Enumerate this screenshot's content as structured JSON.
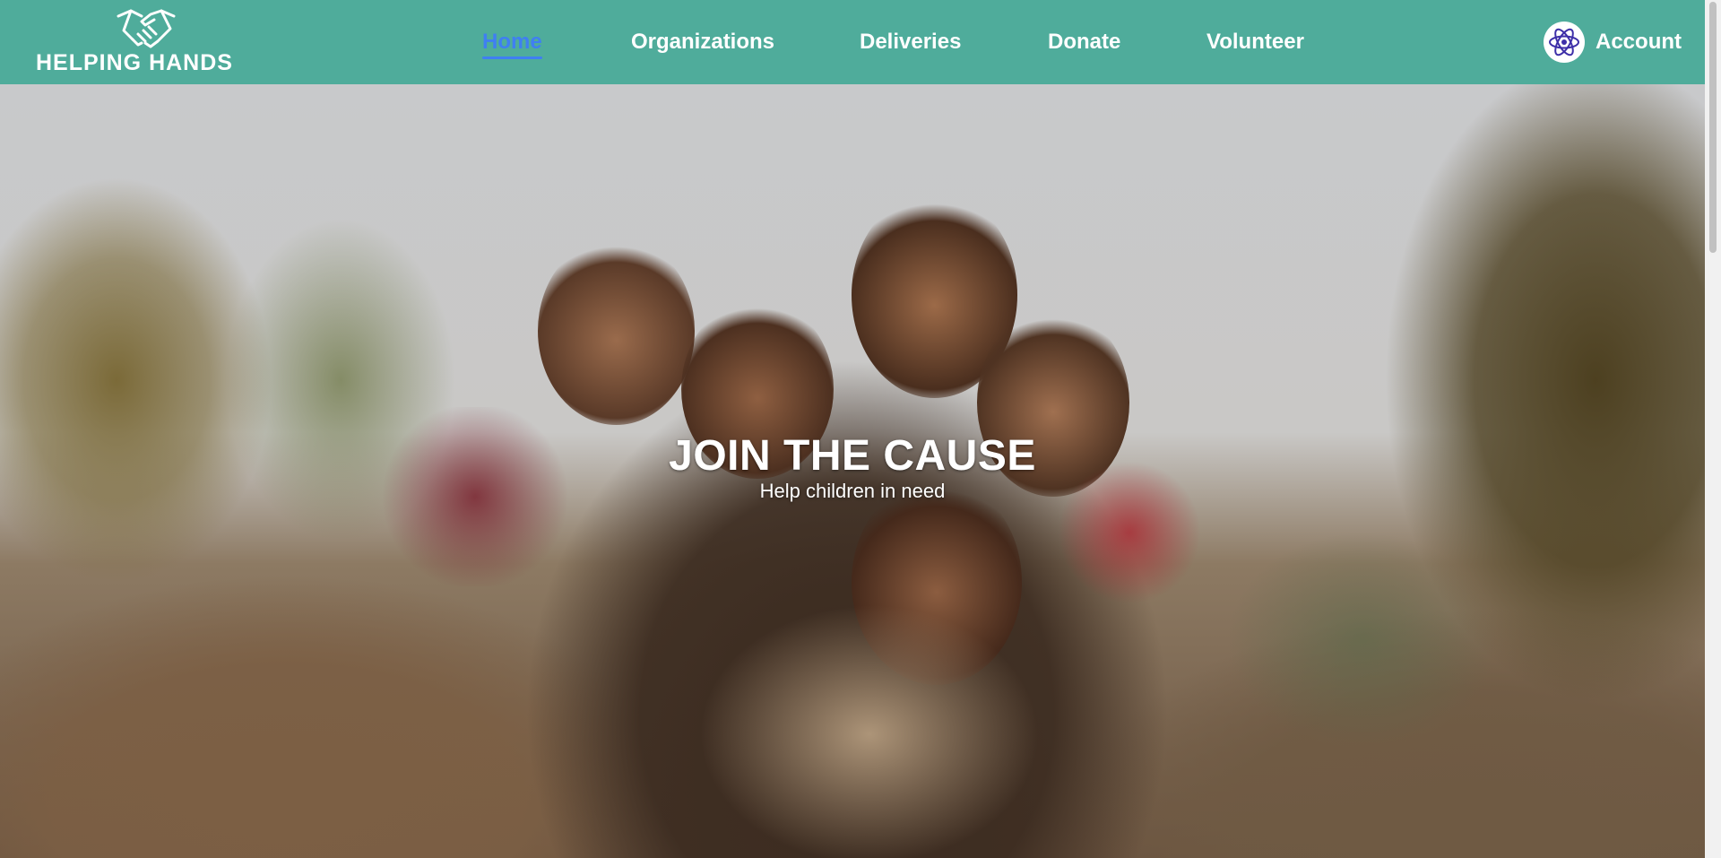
{
  "brand": {
    "name": "HELPING HANDS",
    "logo_icon": "handshake-icon",
    "color": "#4fac9b"
  },
  "nav": {
    "items": [
      {
        "label": "Home",
        "active": true
      },
      {
        "label": "Organizations",
        "active": false
      },
      {
        "label": "Deliveries",
        "active": false
      },
      {
        "label": "Donate",
        "active": false
      },
      {
        "label": "Volunteer",
        "active": false
      }
    ],
    "active_color": "#3f7ff2"
  },
  "account": {
    "label": "Account",
    "avatar_icon": "react-atom-icon"
  },
  "hero": {
    "title": "JOIN THE CAUSE",
    "subtitle": "Help children in need",
    "image": "photo-of-children"
  }
}
